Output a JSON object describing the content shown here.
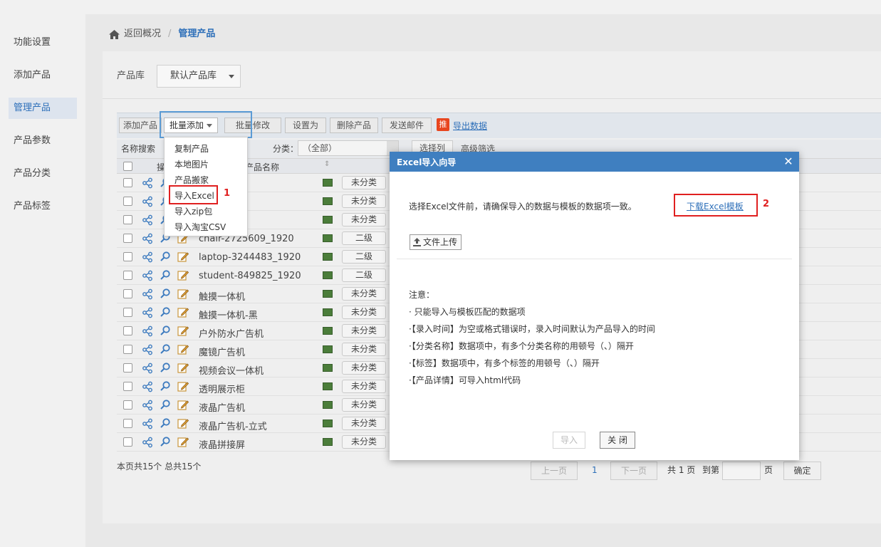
{
  "sidebar": {
    "items": [
      "功能设置",
      "添加产品",
      "管理产品",
      "产品参数",
      "产品分类",
      "产品标签"
    ],
    "active_index": 2
  },
  "breadcrumb": {
    "back": "返回概况",
    "sep": "/",
    "current": "管理产品"
  },
  "library": {
    "label": "产品库",
    "value": "默认产品库"
  },
  "toolbar": {
    "add": "添加产品",
    "batch_add": "批量添加",
    "batch_edit": "批量修改",
    "set_as": "设置为",
    "delete": "删除产品",
    "send_mail": "发送邮件",
    "tui": "推",
    "export": "导出数据"
  },
  "filter": {
    "search": "名称搜索",
    "category": "分类：",
    "all": "（全部）",
    "columns": "选择列",
    "advanced": "高级筛选"
  },
  "table": {
    "name_header": "产品名称",
    "rows": [
      {
        "name": "",
        "tag": "未分类"
      },
      {
        "name": "",
        "tag": "未分类"
      },
      {
        "name": "",
        "tag": "未分类"
      },
      {
        "name": "chair-2725609_1920",
        "tag": "二级"
      },
      {
        "name": "laptop-3244483_1920",
        "tag": "二级"
      },
      {
        "name": "student-849825_1920",
        "tag": "二级"
      },
      {
        "name": "触摸一体机",
        "tag": "未分类"
      },
      {
        "name": "触摸一体机-黑",
        "tag": "未分类"
      },
      {
        "name": "户外防水广告机",
        "tag": "未分类"
      },
      {
        "name": "魔镜广告机",
        "tag": "未分类"
      },
      {
        "name": "视频会议一体机",
        "tag": "未分类"
      },
      {
        "name": "透明展示柜",
        "tag": "未分类"
      },
      {
        "name": "液晶广告机",
        "tag": "未分类"
      },
      {
        "name": "液晶广告机-立式",
        "tag": "未分类"
      },
      {
        "name": "液晶拼接屏",
        "tag": "未分类"
      }
    ]
  },
  "footer": {
    "count": "本页共15个 总共15个"
  },
  "pager": {
    "prev": "上一页",
    "page": "1",
    "next": "下一页",
    "total": "共 1 页",
    "goto": "到第",
    "page_unit": "页",
    "confirm": "确定"
  },
  "dropdown": {
    "items": [
      "复制产品",
      "本地图片",
      "产品搬家",
      "导入Excel",
      "导入zip包",
      "导入淘宝CSV"
    ]
  },
  "annotations": {
    "one": "1",
    "two": "2"
  },
  "modal": {
    "title": "Excel导入向导",
    "close": "✕",
    "desc": "选择Excel文件前，请确保导入的数据与模板的数据项一致。",
    "download": "下载Excel模板",
    "upload": "文件上传",
    "notes_title": "注意：",
    "notes": [
      "· 只能导入与模板匹配的数据项",
      "·【录入时间】为空或格式错误时，录入时间默认为产品导入的时间",
      "·【分类名称】数据项中，有多个分类名称的用顿号（、）隔开",
      "·【标签】数据项中，有多个标签的用顿号（、）隔开",
      "·【产品详情】可导入html代码"
    ],
    "import_btn": "导入",
    "close_btn": "关 闭"
  },
  "colors": {
    "accent": "#2d6fb9",
    "modal_header": "#3f7fc0",
    "highlight_red": "#e02020"
  }
}
